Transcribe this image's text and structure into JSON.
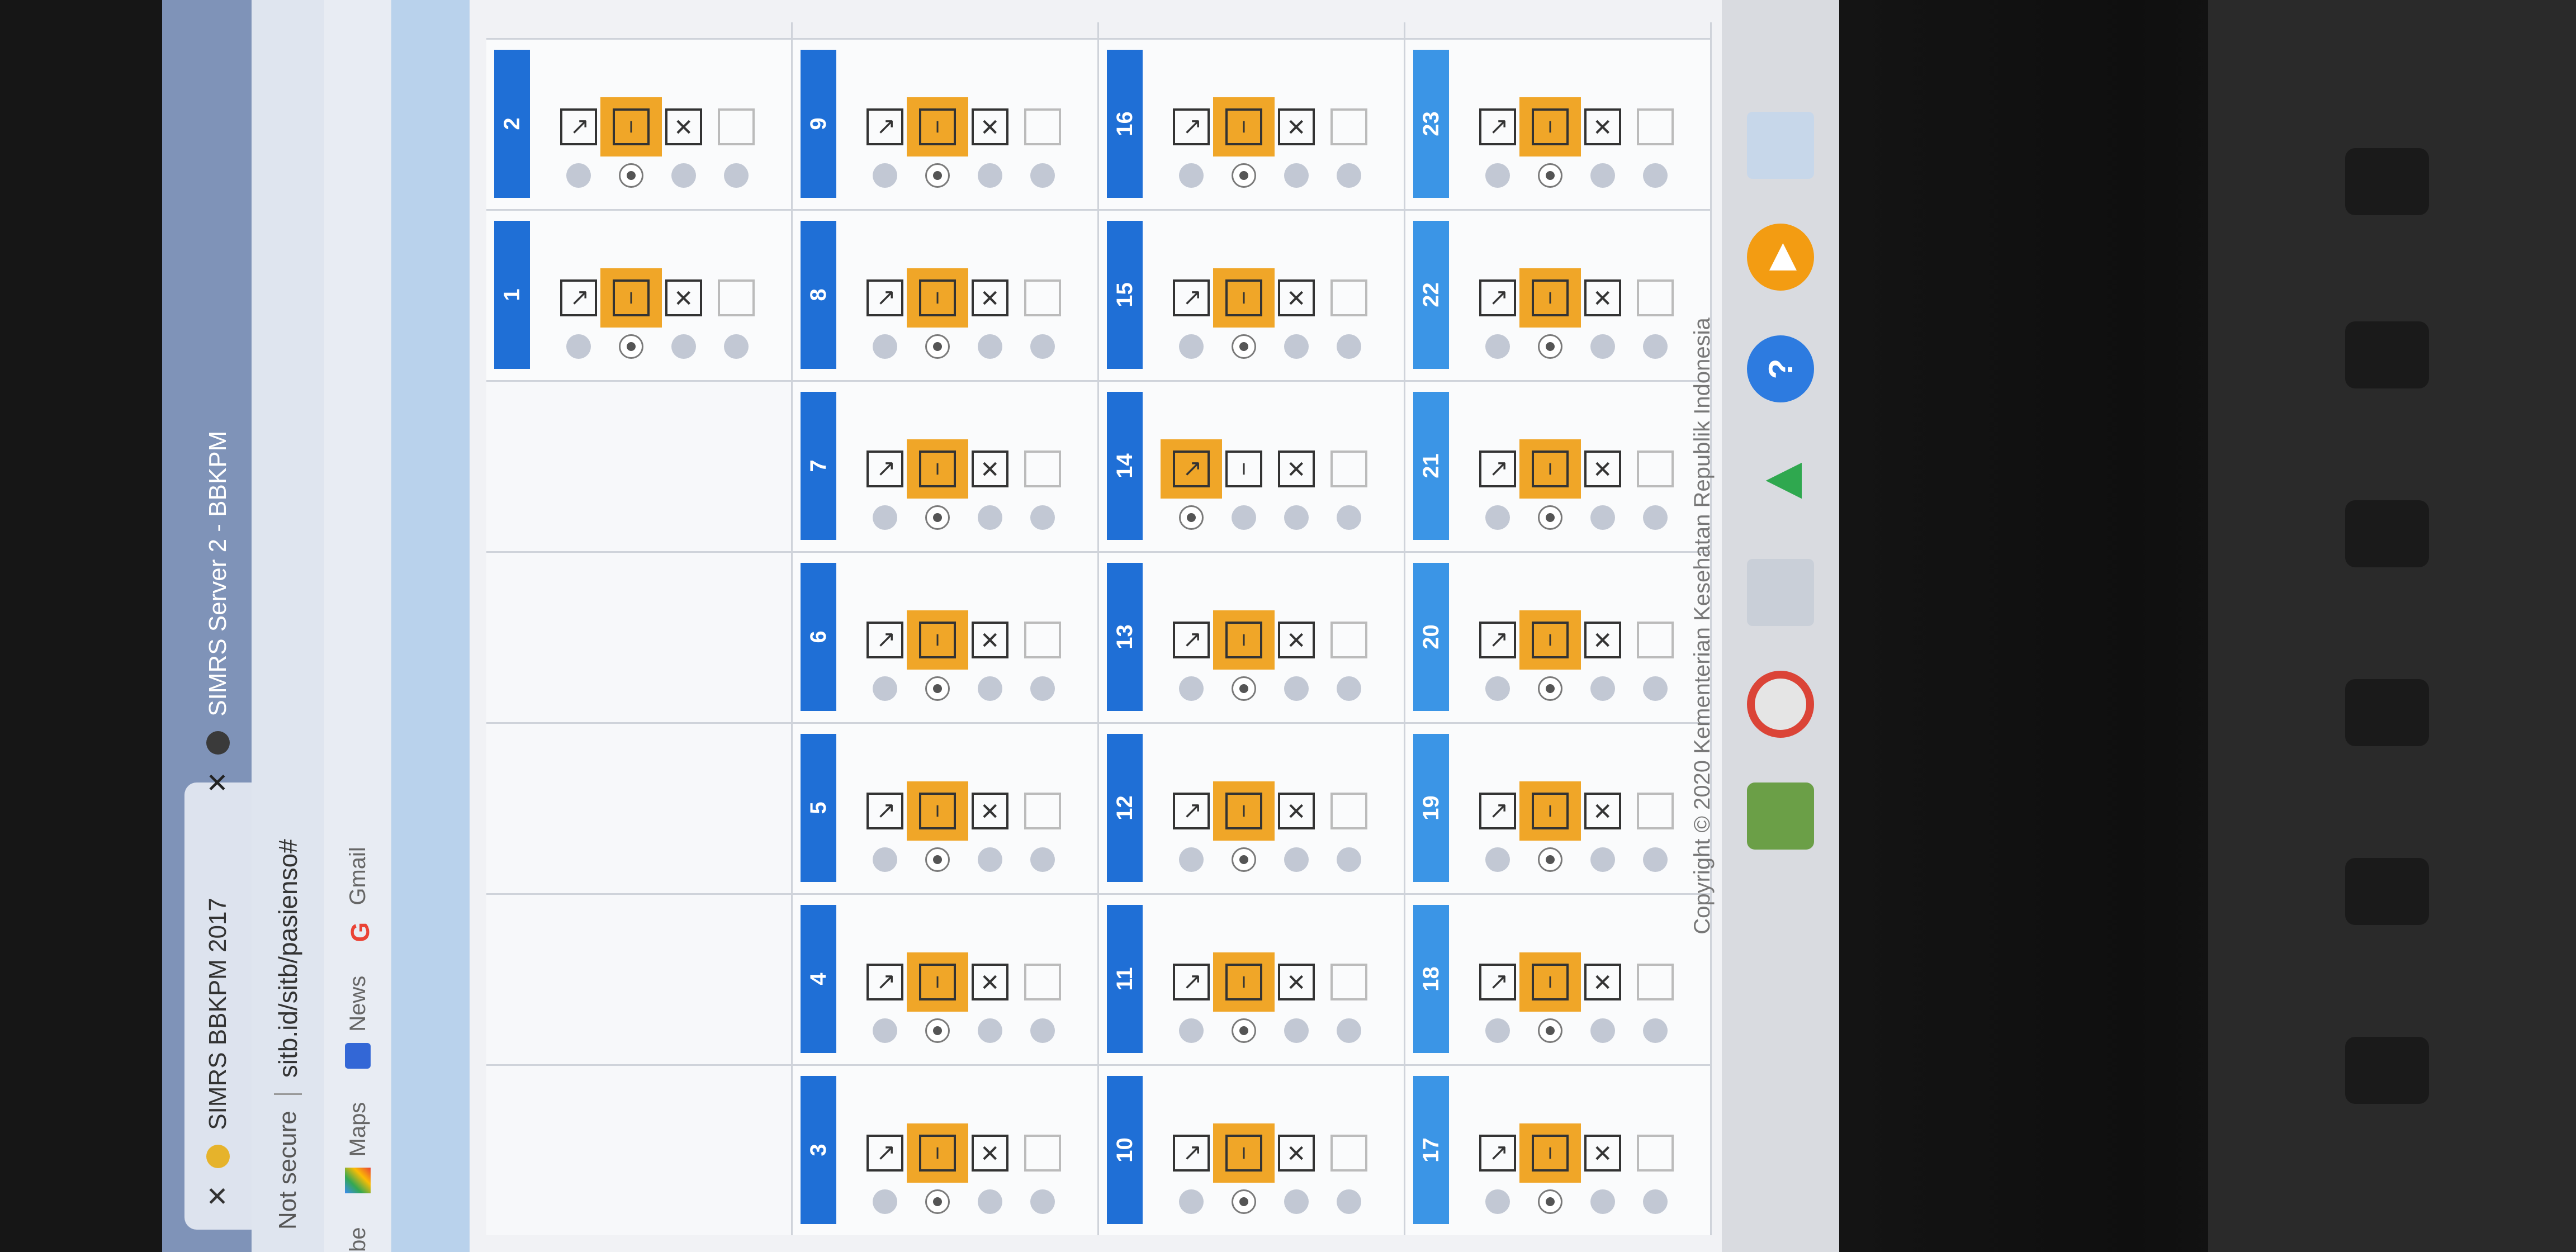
{
  "browser": {
    "tabs": [
      {
        "title": "SIMRS BBKPM 2017",
        "icon": "favicon-leaf-icon"
      },
      {
        "title": "SIMRS Server 2 - BBKPM",
        "icon": "globe-icon"
      }
    ],
    "security_label": "Not secure",
    "url": "sitb.id/sitb/pasienso#",
    "bookmarks": [
      {
        "label": "be",
        "icon": "bookmark-icon"
      },
      {
        "label": "Maps",
        "icon": "maps-icon"
      },
      {
        "label": "News",
        "icon": "news-icon"
      },
      {
        "label": "Gmail",
        "icon": "google-icon"
      }
    ]
  },
  "calendar": {
    "weeks": [
      [
        null,
        null,
        null,
        null,
        null,
        "1",
        "2"
      ],
      [
        "3",
        "4",
        "5",
        "6",
        "7",
        "8",
        "9"
      ],
      [
        "10",
        "11",
        "12",
        "13",
        "14",
        "15",
        "16"
      ],
      [
        "17",
        "18",
        "19",
        "20",
        "21",
        "22",
        "23"
      ]
    ],
    "highlight_note": "Day 14 has check icon highlighted; others have minus icon highlighted"
  },
  "footer": {
    "copyright": "Copyright © 2020 Kementerian Kesehatan Republik Indonesia"
  },
  "colors": {
    "day_header": "#1f6fd6",
    "day_header_light": "#3b95e6",
    "highlight": "#f0a628"
  }
}
